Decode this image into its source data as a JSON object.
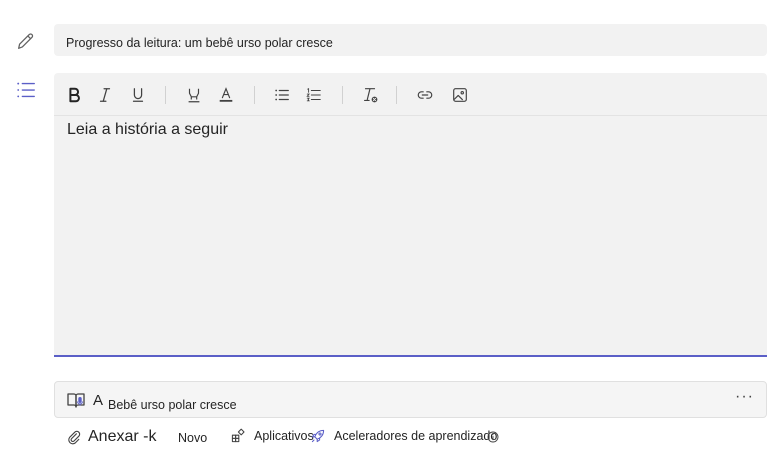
{
  "title_field": {
    "value": "Progresso da leitura: um bebê urso polar cresce"
  },
  "editor": {
    "toolbar": {
      "buttons": [
        "bold-icon",
        "italic-icon",
        "underline-icon",
        "highlight-icon",
        "font-color-icon",
        "bullet-list-icon",
        "numbered-list-icon",
        "clear-formatting-icon",
        "link-icon",
        "image-icon"
      ]
    },
    "body_text": "Leia a história a seguir"
  },
  "attachment": {
    "prefix": "A",
    "name": "Bebê urso polar cresce",
    "more": "···"
  },
  "bottom_bar": {
    "attach_label": "Anexar -k",
    "new_label": "Novo",
    "apps_label": "Aplicativos",
    "accelerators_label": "Aceleradores de aprendizado"
  },
  "colors": {
    "accent": "#5b5fc7",
    "field_bg": "#f2f2f2"
  }
}
